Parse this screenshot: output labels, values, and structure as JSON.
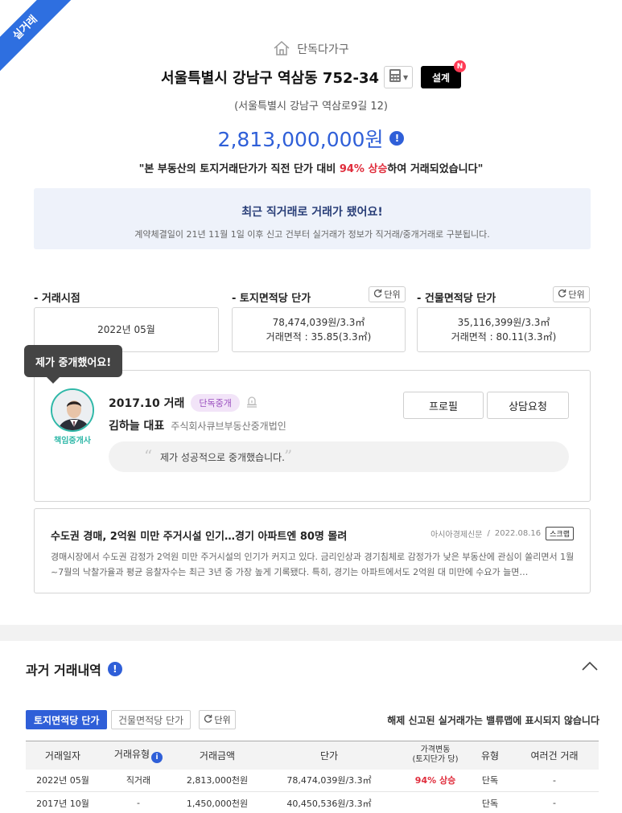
{
  "ribbon": "실거래",
  "property": {
    "type": "단독다가구",
    "address": "서울특별시 강남구 역삼동 752-34",
    "road_address": "(서울특별시 강남구 역삼로9길 12)",
    "price": "2,813,000,000원",
    "design_button": "설계",
    "design_badge": "N",
    "summary_pre": "\"본 부동산의 토지거래단가가 직전 단가 대비 ",
    "summary_highlight": "94% 상승",
    "summary_post": "하여 거래되었습니다\""
  },
  "notice": {
    "title": "최근 직거래로 거래가 됐어요!",
    "subtitle": "계약체결일이 21년 11월 1일 이후 신고 건부터 실거래가 정보가 직거래/중개거래로 구분됩니다."
  },
  "stats": {
    "unit_label": "단위",
    "trade_time_label": "- 거래시점",
    "trade_time_value": "2022년 05월",
    "land_label": "- 토지면적당 단가",
    "land_price": "78,474,039원/3.3㎡",
    "land_area": "거래면적 : 35.85(3.3㎡)",
    "building_label": "- 건물면적당 단가",
    "building_price": "35,116,399원/3.3㎡",
    "building_area": "거래면적 : 80.11(3.3㎡)"
  },
  "agent": {
    "tooltip": "제가 중개했어요!",
    "avatar_label": "책임중개사",
    "deal_date": "2017.10 거래",
    "deal_badge": "단독중개",
    "name": "김하늘 대표",
    "company": "주식회사큐브부동산중개법인",
    "profile_button": "프로필",
    "consult_button": "상담요청",
    "quote": "제가 성공적으로 중개했습니다."
  },
  "news": {
    "title": "수도권 경매, 2억원 미만 주거시설 인기…경기 아파트엔 80명 몰려",
    "source": "아시아경제신문",
    "date": "2022.08.16",
    "scrap": "스크랩",
    "body": "경매시장에서 수도권 감정가 2억원 미만 주거시설의 인기가 커지고 있다. 금리인상과 경기침체로 감정가가 낮은 부동산에 관심이 쏠리면서 1월~7월의 낙찰가율과 평균 응찰자수는 최근 3년 중 가장 높게 기록됐다. 특히, 경기는 아파트에서도 2억원 대 미만에 수요가 늘면…"
  },
  "history": {
    "title": "과거 거래내역",
    "tab_land": "토지면적당 단가",
    "tab_building": "건물면적당 단가",
    "unit_label": "단위",
    "note": "해제 신고된 실거래가는 밸류맵에 표시되지 않습니다",
    "columns": {
      "date": "거래일자",
      "type": "거래유형",
      "amount": "거래금액",
      "unit_price": "단가",
      "change_line1": "가격변동",
      "change_line2": "(토지단가 당)",
      "kind": "유형",
      "multi": "여러건 거래"
    },
    "rows": [
      {
        "date": "2022년 05월",
        "type": "직거래",
        "amount": "2,813,000천원",
        "unit_price": "78,474,039원/3.3㎡",
        "change": "94% 상승",
        "kind": "단독",
        "multi": "-"
      },
      {
        "date": "2017년 10월",
        "type": "-",
        "amount": "1,450,000천원",
        "unit_price": "40,450,536원/3.3㎡",
        "change": "",
        "kind": "단독",
        "multi": "-"
      }
    ]
  }
}
